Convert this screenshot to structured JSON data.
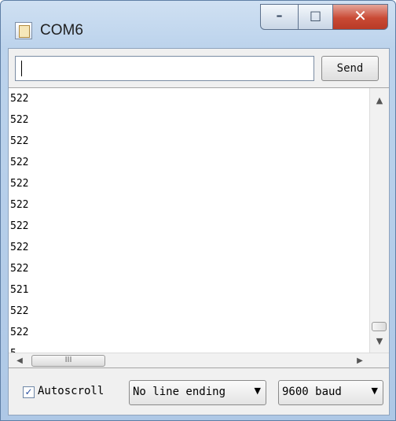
{
  "window": {
    "title": "COM6",
    "icon": "serial-monitor-icon"
  },
  "caption_buttons": {
    "minimize_icon": "minimize-icon",
    "maximize_icon": "maximize-icon",
    "close_icon": "close-icon"
  },
  "send_bar": {
    "input_value": "",
    "send_label": "Send"
  },
  "output": {
    "lines": [
      "522",
      "522",
      "522",
      "522",
      "522",
      "522",
      "522",
      "522",
      "522",
      "521",
      "522",
      "522",
      "5"
    ]
  },
  "scrollbars": {
    "horizontal_thumb_grip": "III"
  },
  "footer": {
    "autoscroll_label": "Autoscroll",
    "autoscroll_checked": true,
    "line_ending_value": "No line ending",
    "baud_value": "9600 baud"
  }
}
